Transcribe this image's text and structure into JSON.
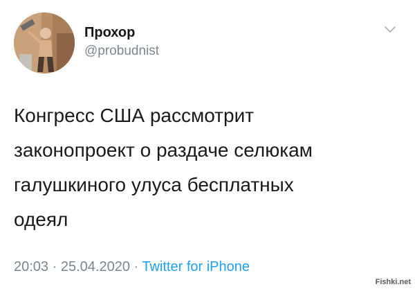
{
  "user": {
    "display_name": "Прохор",
    "handle": "@probudnist",
    "avatar_icon": "user-avatar-photo"
  },
  "tweet": {
    "text": "Конгресс США рассмотрит\nзаконопроект о раздаче селюкам\nгалушкиного улуса бесплатных\nодеял",
    "time": "20:03",
    "separator_1": " · ",
    "date": "25.04.2020",
    "separator_2": " · ",
    "source": "Twitter for iPhone"
  },
  "menu": {
    "icon": "chevron-down-icon"
  },
  "watermark": {
    "text": "Fishki.net"
  },
  "colors": {
    "link": "#1da1f2",
    "muted": "#7a8791",
    "text": "#14171a"
  }
}
